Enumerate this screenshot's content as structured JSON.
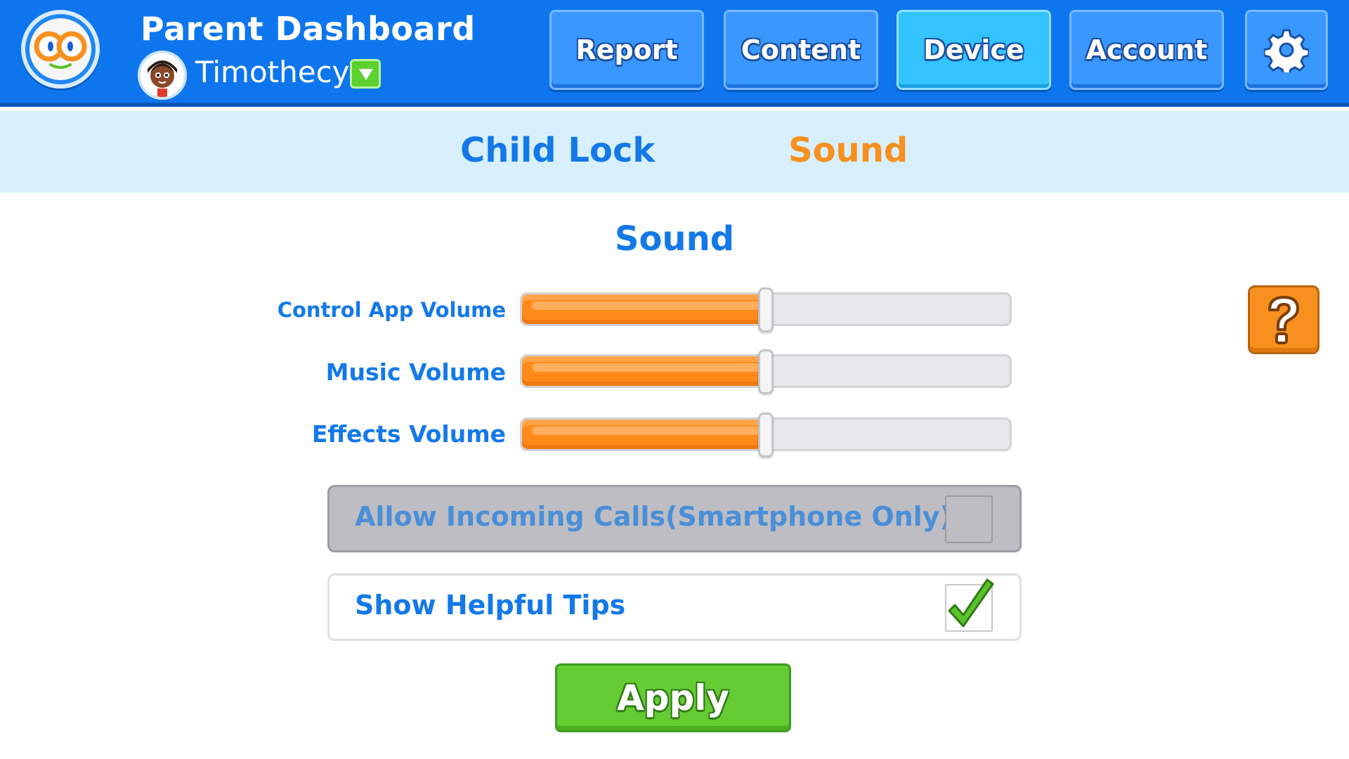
{
  "header": {
    "title": "Parent Dashboard",
    "child_name": "Timothecy",
    "nav": {
      "report": "Report",
      "content": "Content",
      "device": "Device",
      "account": "Account"
    },
    "active_nav": "Device",
    "icons": {
      "logo": "owl-eyes-logo-icon",
      "avatar": "child-avatar-icon",
      "dropdown": "chevron-down-icon",
      "settings": "gear-icon"
    }
  },
  "subtabs": {
    "child_lock": "Child Lock",
    "sound": "Sound",
    "active": "Sound"
  },
  "section": {
    "title": "Sound",
    "sliders": [
      {
        "label": "Control App Volume",
        "value": 0.5
      },
      {
        "label": "Music Volume",
        "value": 0.5
      },
      {
        "label": "Effects Volume",
        "value": 0.5
      }
    ],
    "options": {
      "incoming_calls": {
        "label": "Allow Incoming Calls(Smartphone Only)",
        "checked": false,
        "disabled": true
      },
      "helpful_tips": {
        "label": "Show Helpful Tips",
        "checked": true,
        "disabled": false
      }
    },
    "apply_label": "Apply",
    "help_icon": "question-mark-icon"
  },
  "colors": {
    "header_blue": "#0d76ee",
    "active_tab_orange": "#f7901e",
    "label_blue": "#1479e8",
    "slider_fill": "#ff8a1a",
    "apply_green": "#66cc33"
  }
}
